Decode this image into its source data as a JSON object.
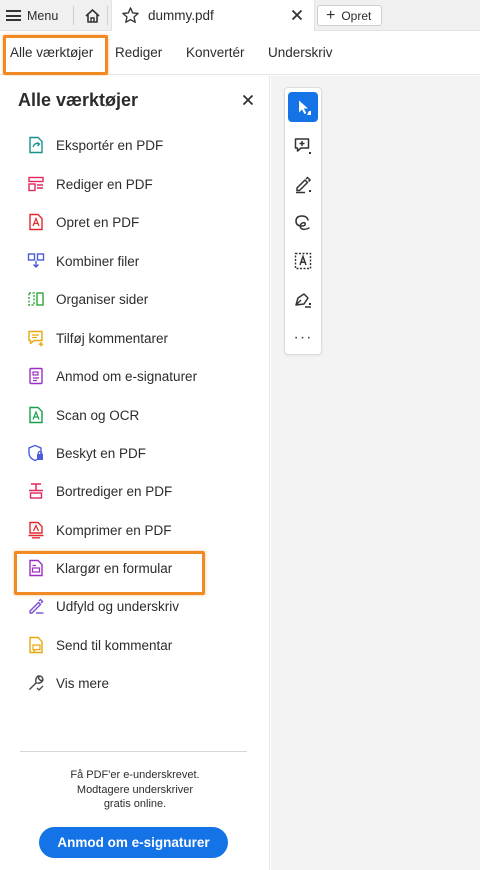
{
  "tabbar": {
    "menu_label": "Menu",
    "tab_title": "dummy.pdf",
    "new_tab_label": "Opret"
  },
  "nav": {
    "items": [
      {
        "label": "Alle værktøjer"
      },
      {
        "label": "Rediger"
      },
      {
        "label": "Konvertér"
      },
      {
        "label": "Underskriv"
      }
    ]
  },
  "panel": {
    "title": "Alle værktøjer",
    "tools": [
      {
        "label": "Eksportér en PDF",
        "icon": "export-pdf-icon",
        "color": "#17928a"
      },
      {
        "label": "Rediger en PDF",
        "icon": "edit-pdf-icon",
        "color": "#e0285c"
      },
      {
        "label": "Opret en PDF",
        "icon": "create-pdf-icon",
        "color": "#e0282e"
      },
      {
        "label": "Kombiner filer",
        "icon": "combine-files-icon",
        "color": "#4b5dd8"
      },
      {
        "label": "Organiser sider",
        "icon": "organize-pages-icon",
        "color": "#2ea836"
      },
      {
        "label": "Tilføj kommentarer",
        "icon": "add-comments-icon",
        "color": "#e8a80c"
      },
      {
        "label": "Anmod om e-signaturer",
        "icon": "request-esign-icon",
        "color": "#9c2fc4"
      },
      {
        "label": "Scan og OCR",
        "icon": "scan-ocr-icon",
        "color": "#17a04a"
      },
      {
        "label": "Beskyt en PDF",
        "icon": "protect-pdf-icon",
        "color": "#4b5dd8"
      },
      {
        "label": "Bortrediger en PDF",
        "icon": "redact-pdf-icon",
        "color": "#e0285c"
      },
      {
        "label": "Komprimer en PDF",
        "icon": "compress-pdf-icon",
        "color": "#e0282e"
      },
      {
        "label": "Klargør en formular",
        "icon": "prepare-form-icon",
        "color": "#9c2fc4"
      },
      {
        "label": "Udfyld og underskriv",
        "icon": "fill-sign-icon",
        "color": "#7a4fd0"
      },
      {
        "label": "Send til kommentar",
        "icon": "send-comment-icon",
        "color": "#e8a80c"
      },
      {
        "label": "Vis mere",
        "icon": "wrench-icon",
        "color": "#444444"
      }
    ],
    "promo_lines": [
      "Få PDF'er e-underskrevet.",
      "Modtagere underskriver",
      "gratis online."
    ],
    "cta_label": "Anmod om e-signaturer"
  },
  "colors": {
    "accent": "#1473e6",
    "highlight": "#f08a24"
  }
}
